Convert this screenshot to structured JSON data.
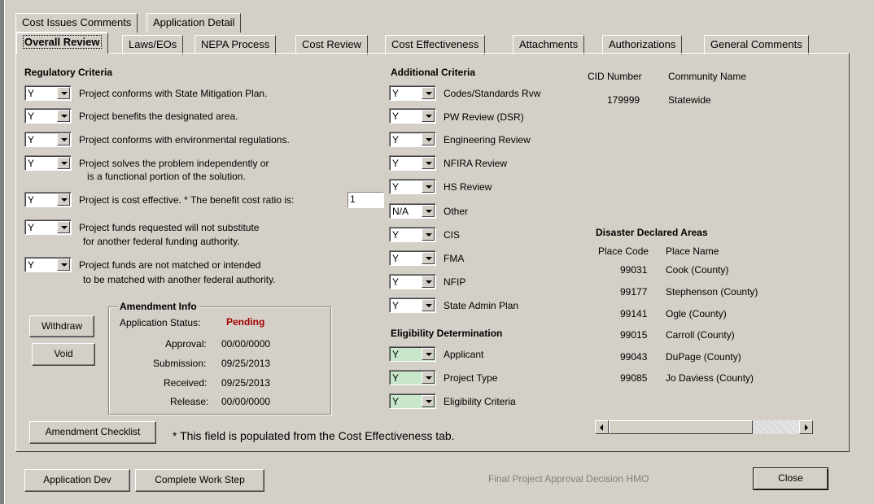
{
  "tabs_top": [
    "Cost Issues Comments",
    "Application Detail"
  ],
  "tabs_main": [
    "Overall Review",
    "Laws/EOs",
    "NEPA Process",
    "Cost Review",
    "Cost Effectiveness",
    "Attachments",
    "Authorizations",
    "General Comments"
  ],
  "regulatory": {
    "header": "Regulatory Criteria",
    "items": [
      {
        "value": "Y",
        "line1": "Project conforms with State Mitigation Plan.",
        "line2": ""
      },
      {
        "value": "Y",
        "line1": "Project benefits the designated area.",
        "line2": ""
      },
      {
        "value": "Y",
        "line1": "Project conforms with environmental regulations.",
        "line2": ""
      },
      {
        "value": "Y",
        "line1": "Project solves the problem independently or",
        "line2": "is a functional portion of the solution."
      },
      {
        "value": "Y",
        "line1": "Project is cost effective.  * The benefit cost ratio is:",
        "line2": ""
      },
      {
        "value": "Y",
        "line1": "Project funds requested will not substitute",
        "line2": "for another federal funding authority."
      },
      {
        "value": "Y",
        "line1": "Project funds are not matched or intended",
        "line2": "to be matched with another federal authority."
      }
    ],
    "bcr_value": "1"
  },
  "additional": {
    "header": "Additional Criteria",
    "items": [
      {
        "value": "Y",
        "label": "Codes/Standards Rvw"
      },
      {
        "value": "Y",
        "label": "PW Review (DSR)"
      },
      {
        "value": "Y",
        "label": "Engineering Review"
      },
      {
        "value": "Y",
        "label": "NFIRA Review"
      },
      {
        "value": "Y",
        "label": "HS Review"
      },
      {
        "value": "N/A",
        "label": "Other"
      },
      {
        "value": "Y",
        "label": "CIS"
      },
      {
        "value": "Y",
        "label": "FMA"
      },
      {
        "value": "Y",
        "label": "NFIP"
      },
      {
        "value": "Y",
        "label": "State Admin Plan"
      }
    ]
  },
  "eligibility": {
    "header": "Eligibility Determination",
    "items": [
      {
        "value": "Y",
        "label": "Applicant"
      },
      {
        "value": "Y",
        "label": "Project Type"
      },
      {
        "value": "Y",
        "label": "Eligibility Criteria"
      }
    ]
  },
  "cid": {
    "col1": "CID Number",
    "col2": "Community Name",
    "number": "179999",
    "name": "Statewide"
  },
  "disaster": {
    "header": "Disaster Declared Areas",
    "col1": "Place Code",
    "col2": "Place Name",
    "rows": [
      {
        "code": "99031",
        "name": "Cook (County)"
      },
      {
        "code": "99177",
        "name": "Stephenson (County)"
      },
      {
        "code": "99141",
        "name": "Ogle (County)"
      },
      {
        "code": "99015",
        "name": "Carroll (County)"
      },
      {
        "code": "99043",
        "name": "DuPage (County)"
      },
      {
        "code": "99085",
        "name": "Jo Daviess (County)"
      }
    ]
  },
  "amendment": {
    "title": "Amendment Info",
    "status_label": "Application Status:",
    "status_value": "Pending",
    "status_color": "#a00000",
    "approval_label": "Approval:",
    "approval_value": "00/00/0000",
    "submission_label": "Submission:",
    "submission_value": "09/25/2013",
    "received_label": "Received:",
    "received_value": "09/25/2013",
    "release_label": "Release:",
    "release_value": "00/00/0000"
  },
  "buttons": {
    "withdraw": "Withdraw",
    "void": "Void",
    "amendment_checklist": "Amendment Checklist",
    "application_dev": "Application Dev",
    "complete_work_step": "Complete Work Step",
    "close": "Close"
  },
  "footnote": "* This field is populated from the Cost Effectiveness tab.",
  "status_text": "Final Project Approval Decision  HMO"
}
